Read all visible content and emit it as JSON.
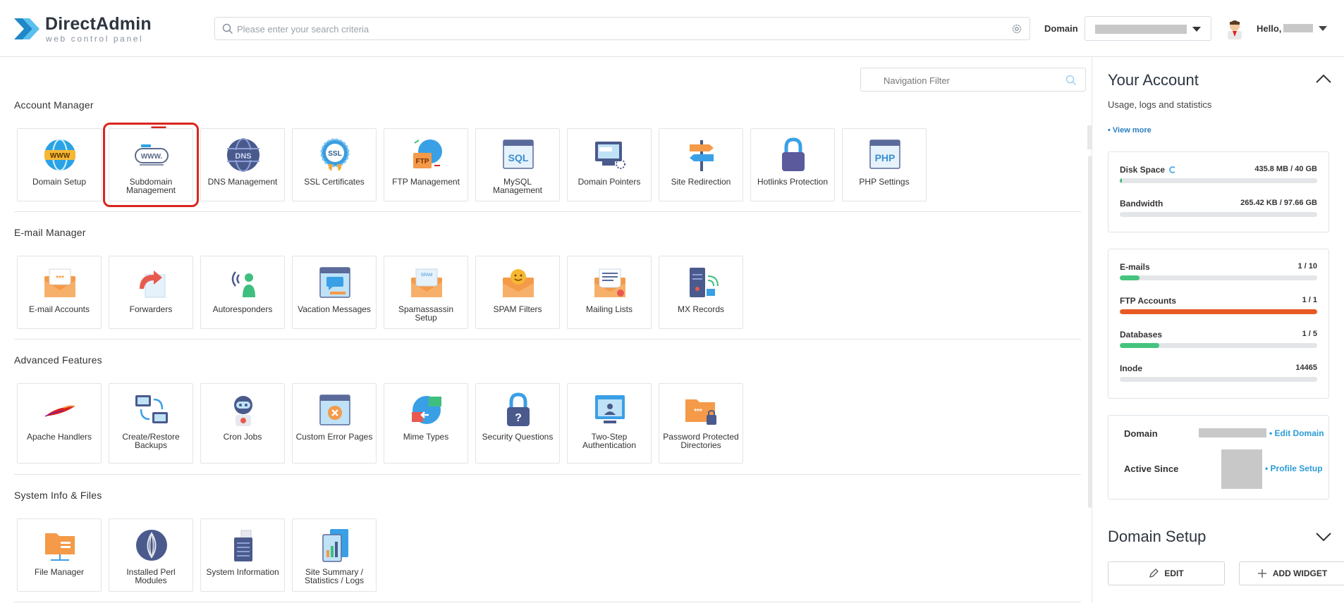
{
  "header": {
    "logo_name": "DirectAdmin",
    "logo_sub": "web control panel",
    "search_placeholder": "Please enter your search criteria",
    "domain_label": "Domain",
    "hello": "Hello,"
  },
  "main": {
    "nav_filter_placeholder": "Navigation Filter",
    "sections": [
      {
        "title": "Account Manager",
        "items": [
          {
            "label": "Domain Setup",
            "icon": "globe-www-icon"
          },
          {
            "label": "Subdomain Management",
            "icon": "subdomain-icon",
            "highlighted": true
          },
          {
            "label": "DNS Management",
            "icon": "dns-icon"
          },
          {
            "label": "SSL Certificates",
            "icon": "ssl-badge-icon"
          },
          {
            "label": "FTP Management",
            "icon": "ftp-icon"
          },
          {
            "label": "MySQL Management",
            "icon": "sql-icon"
          },
          {
            "label": "Domain Pointers",
            "icon": "domain-pointer-icon"
          },
          {
            "label": "Site Redirection",
            "icon": "signpost-icon"
          },
          {
            "label": "Hotlinks Protection",
            "icon": "padlock-icon"
          },
          {
            "label": "PHP Settings",
            "icon": "php-icon"
          }
        ]
      },
      {
        "title": "E-mail Manager",
        "items": [
          {
            "label": "E-mail Accounts",
            "icon": "envelope-icon"
          },
          {
            "label": "Forwarders",
            "icon": "forward-icon"
          },
          {
            "label": "Autoresponders",
            "icon": "autoresponder-icon"
          },
          {
            "label": "Vacation Messages",
            "icon": "vacation-icon"
          },
          {
            "label": "Spamassassin Setup",
            "icon": "spam-envelope-icon"
          },
          {
            "label": "SPAM Filters",
            "icon": "spam-filter-icon"
          },
          {
            "label": "Mailing Lists",
            "icon": "mailing-list-icon"
          },
          {
            "label": "MX Records",
            "icon": "mx-server-icon"
          }
        ]
      },
      {
        "title": "Advanced Features",
        "items": [
          {
            "label": "Apache Handlers",
            "icon": "apache-feather-icon"
          },
          {
            "label": "Create/Restore Backups",
            "icon": "backup-icon"
          },
          {
            "label": "Cron Jobs",
            "icon": "robot-icon"
          },
          {
            "label": "Custom Error Pages",
            "icon": "error-page-icon"
          },
          {
            "label": "Mime Types",
            "icon": "mime-globe-icon"
          },
          {
            "label": "Security Questions",
            "icon": "security-lock-icon"
          },
          {
            "label": "Two-Step Authentication",
            "icon": "two-step-icon"
          },
          {
            "label": "Password Protected Directories",
            "icon": "protected-folder-icon"
          }
        ]
      },
      {
        "title": "System Info & Files",
        "items": [
          {
            "label": "File Manager",
            "icon": "folder-icon"
          },
          {
            "label": "Installed Perl Modules",
            "icon": "perl-onion-icon"
          },
          {
            "label": "System Information",
            "icon": "server-icon"
          },
          {
            "label": "Site Summary / Statistics / Logs",
            "icon": "statistics-icon"
          }
        ]
      }
    ]
  },
  "sidebar": {
    "title": "Your Account",
    "subtitle": "Usage, logs and statistics",
    "view_more": "• View more",
    "usage": [
      {
        "name": "Disk Space",
        "value": "435.8 MB / 40 GB",
        "fill": 0.011,
        "color": "#3fbf7f"
      },
      {
        "name": "Bandwidth",
        "value": "265.42 KB / 97.66 GB",
        "fill": 0.0,
        "color": "#3fbf7f"
      }
    ],
    "limits": [
      {
        "name": "E-mails",
        "value": "1 / 10",
        "fill": 0.1,
        "color": "#44c47e"
      },
      {
        "name": "FTP Accounts",
        "value": "1 / 1",
        "fill": 1.0,
        "color": "#e85a23"
      },
      {
        "name": "Databases",
        "value": "1 / 5",
        "fill": 0.2,
        "color": "#44c47e"
      },
      {
        "name": "Inode",
        "value": "14465",
        "fill": 0.0,
        "color": "#44c47e"
      }
    ],
    "info": {
      "domain_label": "Domain",
      "edit_domain": "• Edit Domain",
      "active_since_label": "Active Since",
      "profile_setup": "• Profile Setup"
    },
    "domain_setup_title": "Domain Setup",
    "edit_button": "EDIT",
    "add_widget_button": "ADD WIDGET"
  }
}
